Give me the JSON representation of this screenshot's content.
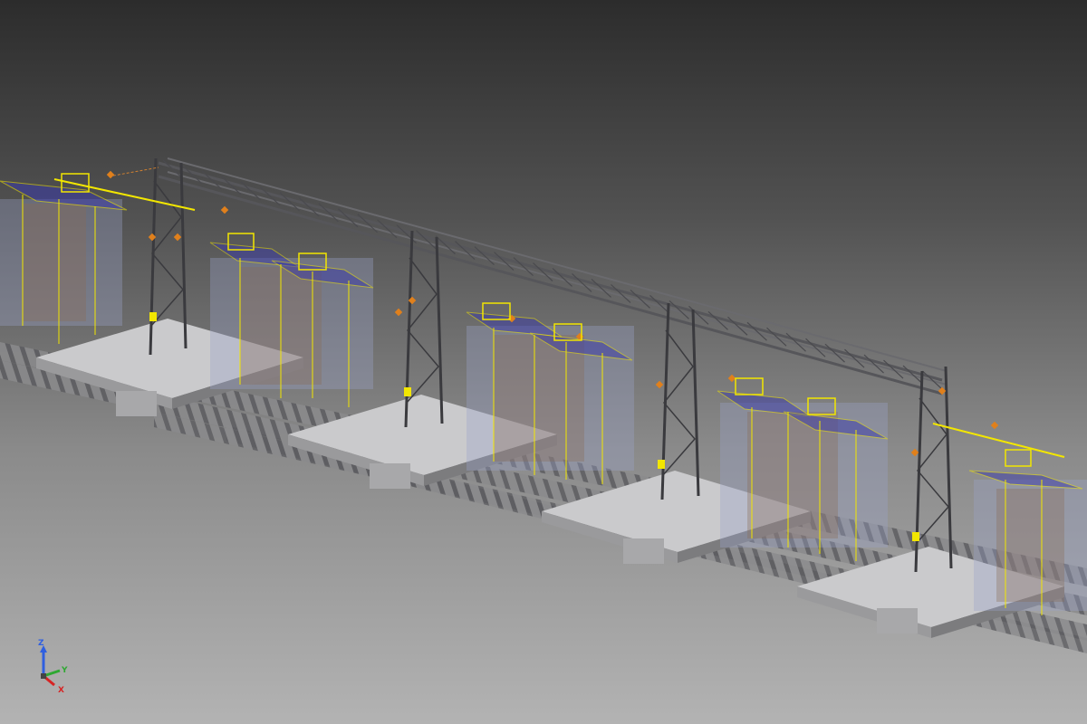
{
  "app": {
    "view": "3d-cad-viewport"
  },
  "scene": {
    "palette": {
      "background_top": "#2c2c2c",
      "background_bottom": "#b3b3b3",
      "steel": "#56565a",
      "steel_dark": "#3a3a3e",
      "foundation": "#c6c6c8",
      "rail": "#6e6e72",
      "envelope_outline": "#f2e600",
      "envelope_fill": "#9aa2c8",
      "envelope_brown": "#8a6a52",
      "blue_zone": "#3a3aa8",
      "fitting_orange": "#e0801c"
    },
    "icons": [
      "portal-gantry-icon",
      "mast-icon",
      "clearance-envelope-icon",
      "track-icon",
      "foundation-icon"
    ]
  },
  "triad": {
    "z_label": "Z",
    "y_label": "Y",
    "x_label": "X",
    "z_color": "#2f5fe0",
    "y_color": "#2ea832",
    "x_color": "#d62424"
  }
}
